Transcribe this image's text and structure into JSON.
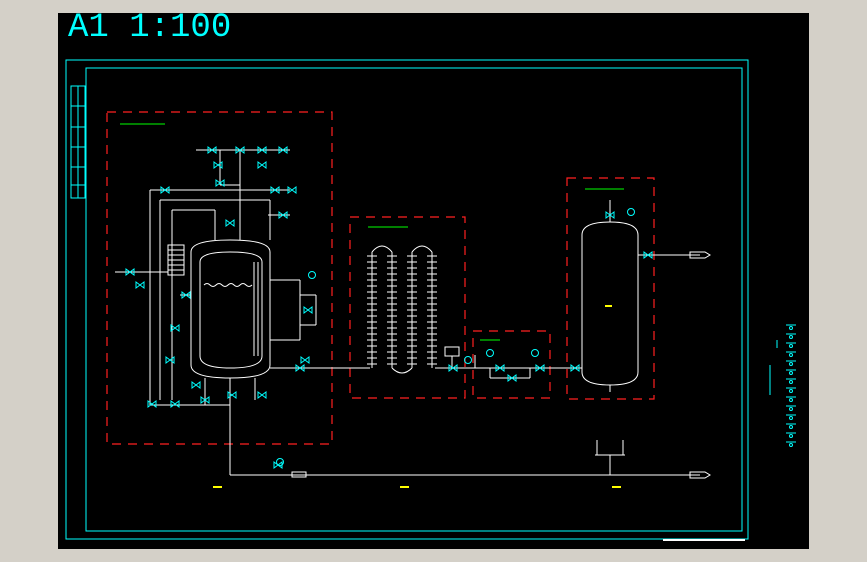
{
  "drawing": {
    "scale_label": "A1 1:100"
  },
  "colors": {
    "background": "#000000",
    "frame": "#00ffff",
    "boundary": "#ff2020",
    "piping": "#ffffff",
    "label": "#00ff00",
    "note": "#ffff00",
    "outer": "#d4d0c8"
  }
}
